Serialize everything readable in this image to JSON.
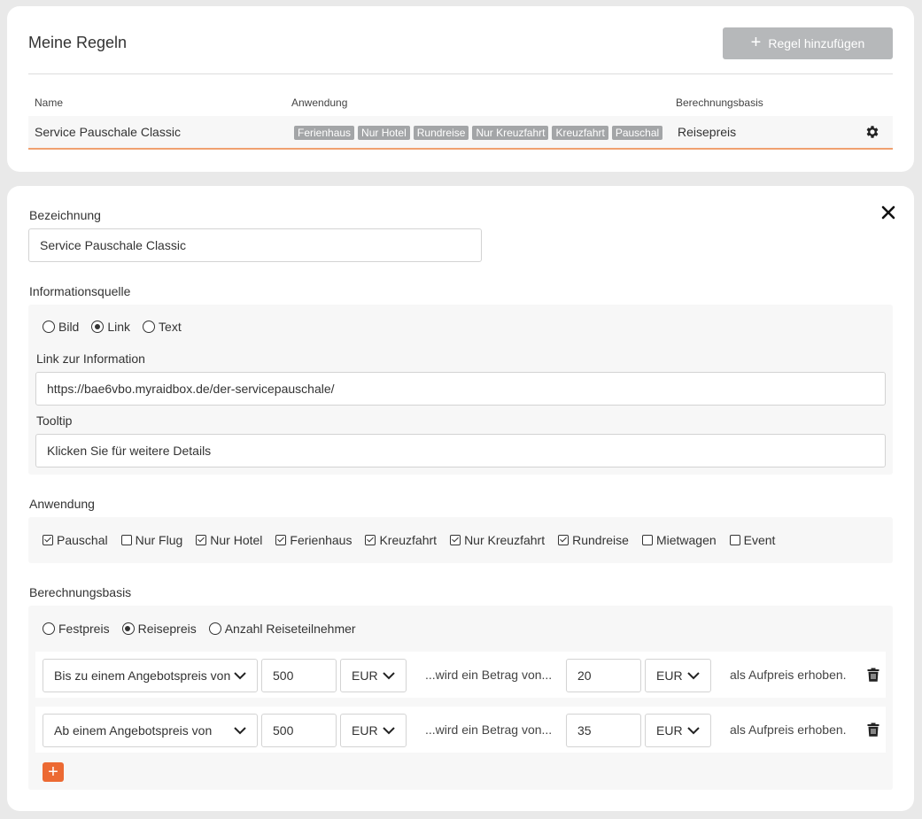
{
  "rules": {
    "title": "Meine Regeln",
    "add_button": "Regel hinzufügen",
    "columns": {
      "name": "Name",
      "application": "Anwendung",
      "basis": "Berechnungsbasis"
    },
    "row": {
      "name": "Service Pauschale Classic",
      "tags": [
        "Ferienhaus",
        "Nur Hotel",
        "Rundreise",
        "Nur Kreuzfahrt",
        "Kreuzfahrt",
        "Pauschal"
      ],
      "basis": "Reisepreis"
    }
  },
  "edit": {
    "designation_label": "Bezeichnung",
    "designation_value": "Service Pauschale Classic",
    "info_source_label": "Informationsquelle",
    "info_source_options": [
      {
        "label": "Bild",
        "checked": false
      },
      {
        "label": "Link",
        "checked": true
      },
      {
        "label": "Text",
        "checked": false
      }
    ],
    "link_label": "Link zur Information",
    "link_value": "https://bae6vbo.myraidbox.de/der-servicepauschale/",
    "tooltip_label": "Tooltip",
    "tooltip_value": "Klicken Sie für weitere Details",
    "application_label": "Anwendung",
    "application_options": [
      {
        "label": "Pauschal",
        "checked": true
      },
      {
        "label": "Nur Flug",
        "checked": false
      },
      {
        "label": "Nur Hotel",
        "checked": true
      },
      {
        "label": "Ferienhaus",
        "checked": true
      },
      {
        "label": "Kreuzfahrt",
        "checked": true
      },
      {
        "label": "Nur Kreuzfahrt",
        "checked": true
      },
      {
        "label": "Rundreise",
        "checked": true
      },
      {
        "label": "Mietwagen",
        "checked": false
      },
      {
        "label": "Event",
        "checked": false
      }
    ],
    "basis_label": "Berechnungsbasis",
    "basis_options": [
      {
        "label": "Festpreis",
        "checked": false
      },
      {
        "label": "Reisepreis",
        "checked": true
      },
      {
        "label": "Anzahl Reiseteilnehmer",
        "checked": false
      }
    ],
    "price_rows": [
      {
        "condition": "Bis zu einem Angebotspreis von",
        "threshold": "500",
        "currency1": "EUR",
        "middle": "...wird ein Betrag von...",
        "amount": "20",
        "currency2": "EUR",
        "suffix": "als Aufpreis erhoben."
      },
      {
        "condition": "Ab einem Angebotspreis von",
        "threshold": "500",
        "currency1": "EUR",
        "middle": "...wird ein Betrag von...",
        "amount": "35",
        "currency2": "EUR",
        "suffix": "als Aufpreis erhoben."
      }
    ],
    "add_row_label": "+"
  },
  "colors": {
    "accent": "#ec6a33",
    "row_underline": "#f0a170",
    "tag_bg": "#a3a5a7",
    "disabled_button": "#b6b8ba"
  },
  "icons": {
    "gear": "gear-icon",
    "close": "close-icon",
    "trash": "trash-icon",
    "chevron": "chevron-down-icon",
    "plus": "plus-icon"
  }
}
